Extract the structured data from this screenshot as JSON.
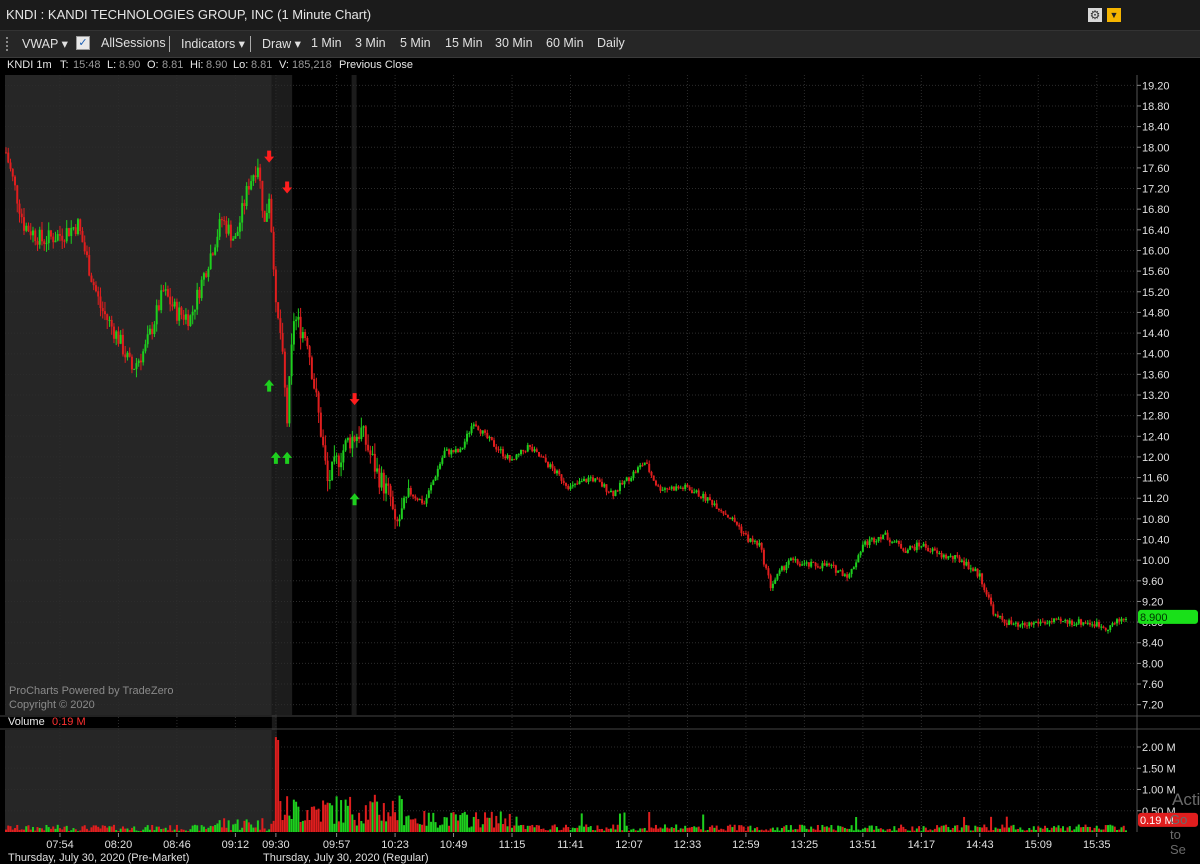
{
  "window": {
    "title": "KNDI : KANDI TECHNOLOGIES GROUP, INC (1 Minute Chart)"
  },
  "toolbar": {
    "vwap": "VWAP ▾",
    "allsessions": "AllSessions",
    "indicators": "Indicators ▾",
    "draw": "Draw ▾",
    "intervals": [
      "1 Min",
      "3 Min",
      "5 Min",
      "15 Min",
      "30 Min",
      "60 Min",
      "Daily"
    ],
    "check_mark": "✓"
  },
  "info": {
    "symbol": "KNDI 1m",
    "t_label": "T:",
    "t_value": "15:48",
    "l_label": "L:",
    "l_value": "8.90",
    "o_label": "O:",
    "o_value": "8.81",
    "hi_label": "Hi:",
    "hi_value": "8.90",
    "lo_label": "Lo:",
    "lo_value": "8.81",
    "v_label": "V:",
    "v_value": "185,218",
    "prev_close": "Previous Close"
  },
  "watermark": {
    "line1": "ProCharts Powered by TradeZero",
    "line2": "Copyright © 2020"
  },
  "volume": {
    "label": "Volume",
    "value": "0.19 M",
    "badge": "0.19 M"
  },
  "sessions": {
    "premarket": "Thursday, July 30, 2020 (Pre-Market)",
    "regular": "Thursday, July 30, 2020 (Regular)"
  },
  "price_badge": "8.900",
  "overlay_text": "Activa",
  "overlay_text2": "Go to Se",
  "colors": {
    "up": "#1ecf1e",
    "down": "#e01e1e",
    "premarket_bg": "#262626",
    "grid": "#2c2c2c"
  },
  "chart_data": {
    "type": "candlestick",
    "title": "KNDI : KANDI TECHNOLOGIES GROUP, INC (1 Minute Chart)",
    "ylim": [
      7.0,
      19.4
    ],
    "y_ticks": [
      "19.20",
      "18.80",
      "18.40",
      "18.00",
      "17.60",
      "17.20",
      "16.80",
      "16.40",
      "16.00",
      "15.60",
      "15.20",
      "14.80",
      "14.40",
      "14.00",
      "13.60",
      "13.20",
      "12.80",
      "12.40",
      "12.00",
      "11.60",
      "11.20",
      "10.80",
      "10.40",
      "10.00",
      "9.60",
      "9.20",
      "8.80",
      "8.40",
      "8.00",
      "7.60",
      "7.20"
    ],
    "x_ticks": [
      "07:54",
      "08:20",
      "08:46",
      "09:12",
      "09:30",
      "09:57",
      "10:23",
      "10:49",
      "11:15",
      "11:41",
      "12:07",
      "12:33",
      "12:59",
      "13:25",
      "13:51",
      "14:17",
      "14:43",
      "15:09",
      "15:35"
    ],
    "volume_ticks": [
      "2.00 M",
      "1.50 M",
      "1.00 M",
      "0.50 M"
    ],
    "volume_ylim": [
      0,
      2.4
    ],
    "last_price": 8.9,
    "path_points": [
      [
        "07:30",
        17.9
      ],
      [
        "07:38",
        16.5
      ],
      [
        "07:46",
        16.2
      ],
      [
        "07:54",
        16.3
      ],
      [
        "08:02",
        16.5
      ],
      [
        "08:08",
        15.5
      ],
      [
        "08:12",
        14.9
      ],
      [
        "08:20",
        14.3
      ],
      [
        "08:26",
        13.7
      ],
      [
        "08:32",
        14.1
      ],
      [
        "08:40",
        15.2
      ],
      [
        "08:46",
        14.8
      ],
      [
        "08:52",
        14.7
      ],
      [
        "09:00",
        15.8
      ],
      [
        "09:06",
        16.6
      ],
      [
        "09:12",
        16.2
      ],
      [
        "09:18",
        17.3
      ],
      [
        "09:22",
        17.7
      ],
      [
        "09:25",
        16.5
      ],
      [
        "09:27",
        17.1
      ],
      [
        "09:29",
        15.8
      ],
      [
        "09:30",
        14.8
      ],
      [
        "09:32",
        14.4
      ],
      [
        "09:35",
        12.7
      ],
      [
        "09:38",
        14.7
      ],
      [
        "09:44",
        14.3
      ],
      [
        "09:50",
        12.5
      ],
      [
        "09:53",
        11.5
      ],
      [
        "09:57",
        11.9
      ],
      [
        "10:02",
        12.3
      ],
      [
        "10:08",
        12.5
      ],
      [
        "10:15",
        11.7
      ],
      [
        "10:21",
        11.2
      ],
      [
        "10:23",
        10.6
      ],
      [
        "10:30",
        11.3
      ],
      [
        "10:36",
        11.1
      ],
      [
        "10:45",
        12.1
      ],
      [
        "10:52",
        12.1
      ],
      [
        "10:58",
        12.7
      ],
      [
        "11:03",
        12.4
      ],
      [
        "11:15",
        11.9
      ],
      [
        "11:22",
        12.2
      ],
      [
        "11:30",
        11.9
      ],
      [
        "11:41",
        11.4
      ],
      [
        "11:50",
        11.6
      ],
      [
        "12:00",
        11.3
      ],
      [
        "12:07",
        11.6
      ],
      [
        "12:14",
        11.9
      ],
      [
        "12:20",
        11.4
      ],
      [
        "12:33",
        11.4
      ],
      [
        "12:45",
        11.1
      ],
      [
        "12:55",
        10.7
      ],
      [
        "13:00",
        10.4
      ],
      [
        "13:05",
        10.3
      ],
      [
        "13:10",
        9.5
      ],
      [
        "13:18",
        10.0
      ],
      [
        "13:25",
        9.9
      ],
      [
        "13:35",
        9.9
      ],
      [
        "13:45",
        9.7
      ],
      [
        "13:51",
        10.3
      ],
      [
        "14:00",
        10.5
      ],
      [
        "14:10",
        10.2
      ],
      [
        "14:17",
        10.3
      ],
      [
        "14:25",
        10.1
      ],
      [
        "14:35",
        10.0
      ],
      [
        "14:43",
        9.7
      ],
      [
        "14:50",
        8.9
      ],
      [
        "15:00",
        8.7
      ],
      [
        "15:09",
        8.8
      ],
      [
        "15:20",
        8.8
      ],
      [
        "15:30",
        8.8
      ],
      [
        "15:40",
        8.7
      ],
      [
        "15:48",
        8.9
      ]
    ],
    "arrows": [
      {
        "time": "09:27",
        "price": 17.8,
        "dir": "down",
        "color": "red"
      },
      {
        "time": "09:35",
        "price": 17.2,
        "dir": "down",
        "color": "red"
      },
      {
        "time": "09:27",
        "price": 13.4,
        "dir": "up",
        "color": "green"
      },
      {
        "time": "09:30",
        "price": 12.0,
        "dir": "up",
        "color": "green"
      },
      {
        "time": "09:35",
        "price": 12.0,
        "dir": "up",
        "color": "green"
      },
      {
        "time": "10:05",
        "price": 13.1,
        "dir": "down",
        "color": "red"
      },
      {
        "time": "10:05",
        "price": 11.2,
        "dir": "up",
        "color": "green"
      }
    ]
  }
}
